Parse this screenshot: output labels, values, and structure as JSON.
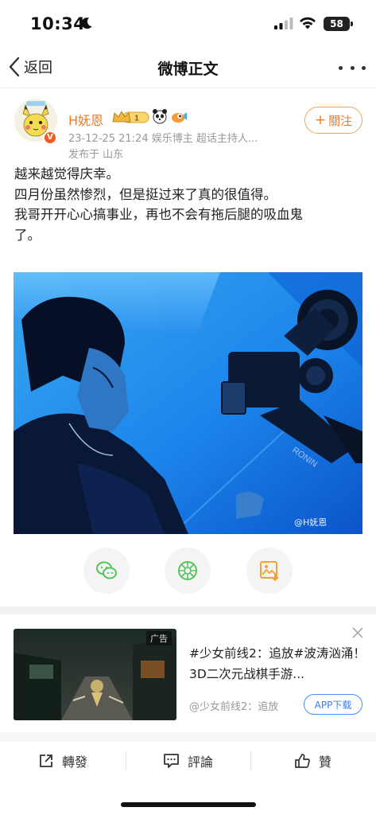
{
  "status_bar": {
    "time": "10:34",
    "battery": "58"
  },
  "nav": {
    "back_label": "返回",
    "title": "微博正文"
  },
  "author": {
    "name": "H妩恩",
    "level_badge": "1",
    "verified_badge": "V",
    "meta_line1": "23-12-25 21:24  娱乐博主 超话主持人...",
    "meta_line2": "发布于 山东",
    "follow_label": "關注"
  },
  "post": {
    "lines": [
      "越来越觉得庆幸。",
      "四月份虽然惨烈，但是挺过来了真的很值得。",
      "我哥开开心心搞事业，再也不会有拖后腿的吸血鬼",
      "了。"
    ],
    "image_watermark": "@H妩恩",
    "camera_brand": "RONIN"
  },
  "share": {
    "icons": [
      "wechat-icon",
      "moments-icon",
      "save-image-icon"
    ]
  },
  "ad": {
    "tag": "广告",
    "title": "#少女前线2：追放#波涛汹涌！3D二次元战棋手游...",
    "source": "@少女前线2：追放",
    "button": "APP下载"
  },
  "actions": {
    "repost": "轉發",
    "comment": "評論",
    "like": "贊"
  },
  "colors": {
    "accent_orange": "#ef7b23",
    "ad_blue": "#3a7ee8",
    "photo_blue": "#1f7fe6"
  }
}
